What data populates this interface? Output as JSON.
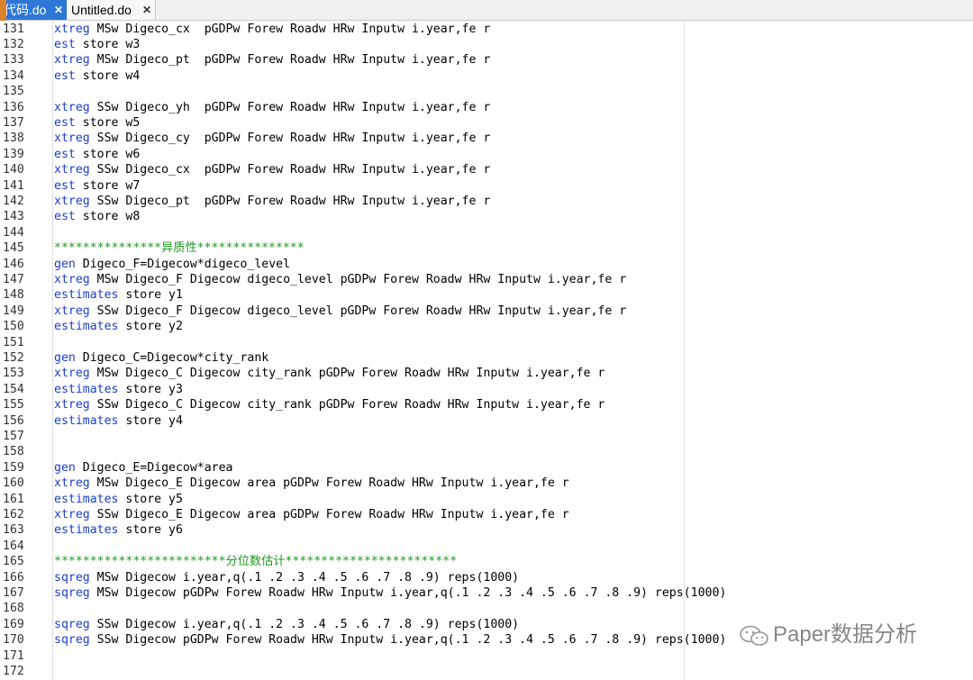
{
  "tabs": [
    {
      "label": "代码.do",
      "close": "✕"
    },
    {
      "label": "Untitled.do",
      "close": "✕"
    }
  ],
  "watermark": "Paper数据分析",
  "colors": {
    "keyword": "#1a3ec7",
    "comment": "#1d9a1d",
    "active_tab": "#2d78d7"
  },
  "lines": [
    {
      "n": "131",
      "kw": "xtreg",
      "rest": " MSw Digeco_cx  pGDPw Forew Roadw HRw Inputw i.year,fe r"
    },
    {
      "n": "132",
      "kw": "est",
      "rest": " store w3"
    },
    {
      "n": "133",
      "kw": "xtreg",
      "rest": " MSw Digeco_pt  pGDPw Forew Roadw HRw Inputw i.year,fe r"
    },
    {
      "n": "134",
      "kw": "est",
      "rest": " store w4"
    },
    {
      "n": "135",
      "kw": "",
      "rest": ""
    },
    {
      "n": "136",
      "kw": "xtreg",
      "rest": " SSw Digeco_yh  pGDPw Forew Roadw HRw Inputw i.year,fe r"
    },
    {
      "n": "137",
      "kw": "est",
      "rest": " store w5"
    },
    {
      "n": "138",
      "kw": "xtreg",
      "rest": " SSw Digeco_cy  pGDPw Forew Roadw HRw Inputw i.year,fe r"
    },
    {
      "n": "139",
      "kw": "est",
      "rest": " store w6"
    },
    {
      "n": "140",
      "kw": "xtreg",
      "rest": " SSw Digeco_cx  pGDPw Forew Roadw HRw Inputw i.year,fe r"
    },
    {
      "n": "141",
      "kw": "est",
      "rest": " store w7"
    },
    {
      "n": "142",
      "kw": "xtreg",
      "rest": " SSw Digeco_pt  pGDPw Forew Roadw HRw Inputw i.year,fe r"
    },
    {
      "n": "143",
      "kw": "est",
      "rest": " store w8"
    },
    {
      "n": "144",
      "kw": "",
      "rest": ""
    },
    {
      "n": "145",
      "kw": "",
      "rest": "",
      "comment": "***************异质性***************"
    },
    {
      "n": "146",
      "kw": "gen",
      "rest": " Digeco_F=Digecow*digeco_level"
    },
    {
      "n": "147",
      "kw": "xtreg",
      "rest": " MSw Digeco_F Digecow digeco_level pGDPw Forew Roadw HRw Inputw i.year,fe r"
    },
    {
      "n": "148",
      "kw": "estimates",
      "rest": " store y1"
    },
    {
      "n": "149",
      "kw": "xtreg",
      "rest": " SSw Digeco_F Digecow digeco_level pGDPw Forew Roadw HRw Inputw i.year,fe r"
    },
    {
      "n": "150",
      "kw": "estimates",
      "rest": " store y2"
    },
    {
      "n": "151",
      "kw": "",
      "rest": ""
    },
    {
      "n": "152",
      "kw": "gen",
      "rest": " Digeco_C=Digecow*city_rank"
    },
    {
      "n": "153",
      "kw": "xtreg",
      "rest": " MSw Digeco_C Digecow city_rank pGDPw Forew Roadw HRw Inputw i.year,fe r"
    },
    {
      "n": "154",
      "kw": "estimates",
      "rest": " store y3"
    },
    {
      "n": "155",
      "kw": "xtreg",
      "rest": " SSw Digeco_C Digecow city_rank pGDPw Forew Roadw HRw Inputw i.year,fe r"
    },
    {
      "n": "156",
      "kw": "estimates",
      "rest": " store y4"
    },
    {
      "n": "157",
      "kw": "",
      "rest": ""
    },
    {
      "n": "158",
      "kw": "",
      "rest": ""
    },
    {
      "n": "159",
      "kw": "gen",
      "rest": " Digeco_E=Digecow*area"
    },
    {
      "n": "160",
      "kw": "xtreg",
      "rest": " MSw Digeco_E Digecow area pGDPw Forew Roadw HRw Inputw i.year,fe r"
    },
    {
      "n": "161",
      "kw": "estimates",
      "rest": " store y5"
    },
    {
      "n": "162",
      "kw": "xtreg",
      "rest": " SSw Digeco_E Digecow area pGDPw Forew Roadw HRw Inputw i.year,fe r"
    },
    {
      "n": "163",
      "kw": "estimates",
      "rest": " store y6"
    },
    {
      "n": "164",
      "kw": "",
      "rest": ""
    },
    {
      "n": "165",
      "kw": "",
      "rest": "",
      "comment": "************************分位数估计************************"
    },
    {
      "n": "166",
      "kw": "sqreg",
      "rest": " MSw Digecow i.year,q(.1 .2 .3 .4 .5 .6 .7 .8 .9) reps(1000)"
    },
    {
      "n": "167",
      "kw": "sqreg",
      "rest": " MSw Digecow pGDPw Forew Roadw HRw Inputw i.year,q(.1 .2 .3 .4 .5 .6 .7 .8 .9) reps(1000)"
    },
    {
      "n": "168",
      "kw": "",
      "rest": ""
    },
    {
      "n": "169",
      "kw": "sqreg",
      "rest": " SSw Digecow i.year,q(.1 .2 .3 .4 .5 .6 .7 .8 .9) reps(1000)"
    },
    {
      "n": "170",
      "kw": "sqreg",
      "rest": " SSw Digecow pGDPw Forew Roadw HRw Inputw i.year,q(.1 .2 .3 .4 .5 .6 .7 .8 .9) reps(1000)"
    },
    {
      "n": "171",
      "kw": "",
      "rest": ""
    },
    {
      "n": "172",
      "kw": "",
      "rest": ""
    }
  ]
}
